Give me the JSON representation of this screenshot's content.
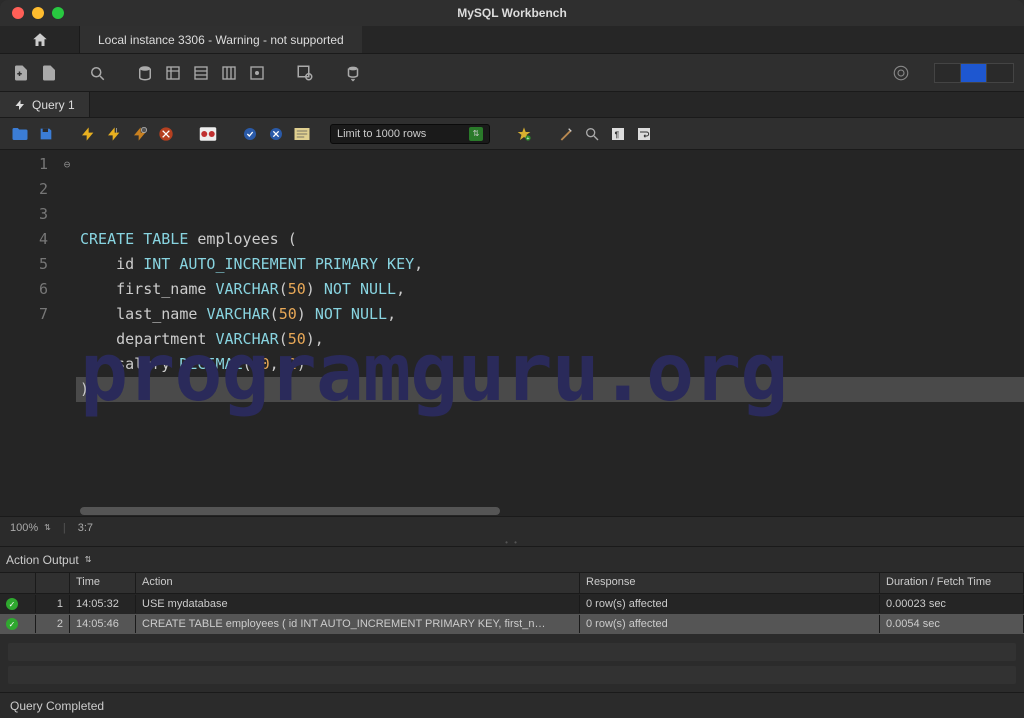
{
  "title": "MySQL Workbench",
  "conn_tab": "Local instance 3306 - Warning - not supported",
  "query_tab": "Query 1",
  "limit_label": "Limit to 1000 rows",
  "zoom": "100%",
  "cursor_pos": "3:7",
  "code_lines": [
    {
      "n": "1",
      "fold": "⊖",
      "tokens": [
        {
          "t": "CREATE TABLE",
          "c": "kw"
        },
        {
          "t": " employees ("
        }
      ]
    },
    {
      "n": "2",
      "fold": "",
      "tokens": [
        {
          "t": "    id "
        },
        {
          "t": "INT",
          "c": "type"
        },
        {
          "t": " "
        },
        {
          "t": "AUTO_INCREMENT",
          "c": "kw"
        },
        {
          "t": " "
        },
        {
          "t": "PRIMARY KEY",
          "c": "kw"
        },
        {
          "t": ","
        }
      ]
    },
    {
      "n": "3",
      "fold": "",
      "tokens": [
        {
          "t": "    first_name "
        },
        {
          "t": "VARCHAR",
          "c": "type"
        },
        {
          "t": "("
        },
        {
          "t": "50",
          "c": "num"
        },
        {
          "t": ") "
        },
        {
          "t": "NOT NULL",
          "c": "kw"
        },
        {
          "t": ","
        }
      ]
    },
    {
      "n": "4",
      "fold": "",
      "tokens": [
        {
          "t": "    last_name "
        },
        {
          "t": "VARCHAR",
          "c": "type"
        },
        {
          "t": "("
        },
        {
          "t": "50",
          "c": "num"
        },
        {
          "t": ") "
        },
        {
          "t": "NOT NULL",
          "c": "kw"
        },
        {
          "t": ","
        }
      ]
    },
    {
      "n": "5",
      "fold": "",
      "tokens": [
        {
          "t": "    department "
        },
        {
          "t": "VARCHAR",
          "c": "type"
        },
        {
          "t": "("
        },
        {
          "t": "50",
          "c": "num"
        },
        {
          "t": "),"
        }
      ]
    },
    {
      "n": "6",
      "fold": "",
      "tokens": [
        {
          "t": "    salary "
        },
        {
          "t": "DECIMAL",
          "c": "type"
        },
        {
          "t": "("
        },
        {
          "t": "10",
          "c": "num"
        },
        {
          "t": ", "
        },
        {
          "t": "2",
          "c": "num"
        },
        {
          "t": ")"
        }
      ]
    },
    {
      "n": "7",
      "fold": "",
      "cur": true,
      "tokens": [
        {
          "t": ");"
        }
      ]
    }
  ],
  "watermark": "programguru.org",
  "output_label": "Action Output",
  "output_cols": {
    "time": "Time",
    "action": "Action",
    "response": "Response",
    "duration": "Duration / Fetch Time"
  },
  "output_rows": [
    {
      "idx": "1",
      "time": "14:05:32",
      "action": "USE mydatabase",
      "response": "0 row(s) affected",
      "duration": "0.00023 sec",
      "sel": false
    },
    {
      "idx": "2",
      "time": "14:05:46",
      "action": "CREATE TABLE employees (     id INT AUTO_INCREMENT PRIMARY KEY,     first_n…",
      "response": "0 row(s) affected",
      "duration": "0.0054 sec",
      "sel": true
    }
  ],
  "footer_status": "Query Completed"
}
